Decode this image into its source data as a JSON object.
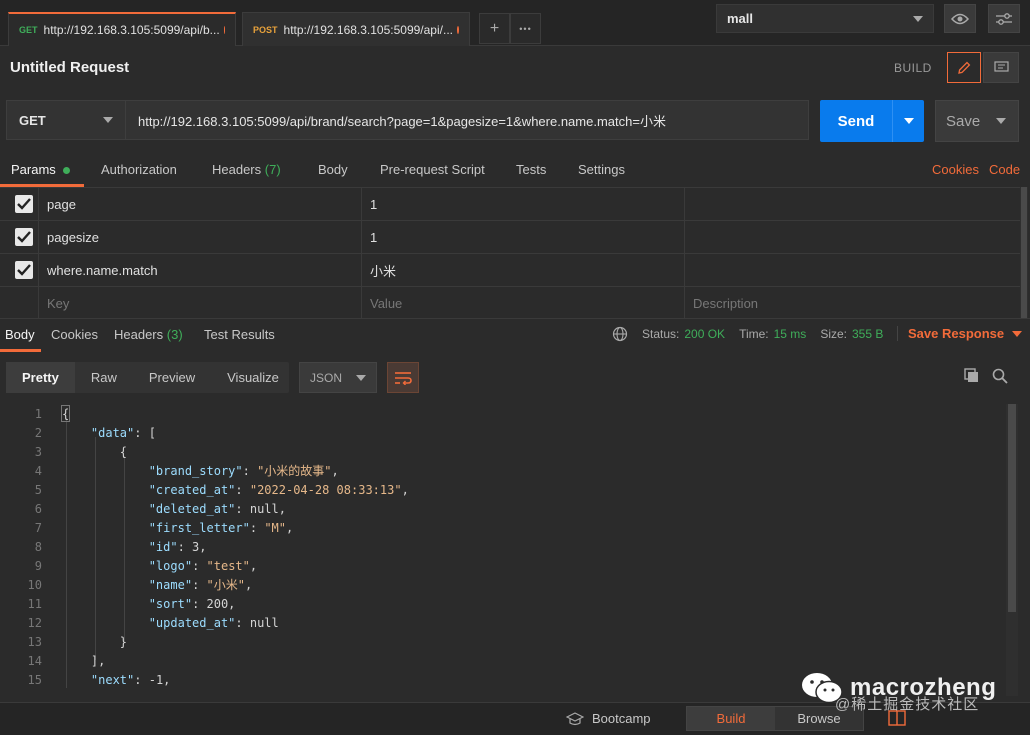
{
  "tabs": [
    {
      "method": "GET",
      "url": "http://192.168.3.105:5099/api/b..."
    },
    {
      "method": "POST",
      "url": "http://192.168.3.105:5099/api/..."
    }
  ],
  "tab_actions": {
    "add": "+",
    "more": "•••"
  },
  "environment": {
    "selected": "mall"
  },
  "request": {
    "title": "Untitled Request",
    "build_label": "BUILD",
    "method": "GET",
    "url": "http://192.168.3.105:5099/api/brand/search?page=1&pagesize=1&where.name.match=小米",
    "send_label": "Send",
    "save_label": "Save"
  },
  "request_tabs": {
    "params": "Params",
    "authorization": "Authorization",
    "headers": "Headers",
    "headers_count": "(7)",
    "body": "Body",
    "prerequest": "Pre-request Script",
    "tests": "Tests",
    "settings": "Settings",
    "cookies": "Cookies",
    "code": "Code"
  },
  "params": [
    {
      "key": "page",
      "value": "1",
      "checked": true
    },
    {
      "key": "pagesize",
      "value": "1",
      "checked": true
    },
    {
      "key": "where.name.match",
      "value": "小米",
      "checked": true
    }
  ],
  "params_placeholder": {
    "key": "Key",
    "value": "Value",
    "description": "Description"
  },
  "response_tabs": {
    "body": "Body",
    "cookies": "Cookies",
    "headers": "Headers",
    "headers_count": "(3)",
    "test_results": "Test Results"
  },
  "response_status": {
    "status_label": "Status:",
    "status_value": "200 OK",
    "time_label": "Time:",
    "time_value": "15 ms",
    "size_label": "Size:",
    "size_value": "355 B",
    "save_response": "Save Response"
  },
  "view_modes": {
    "pretty": "Pretty",
    "raw": "Raw",
    "preview": "Preview",
    "visualize": "Visualize"
  },
  "format": {
    "selected": "JSON"
  },
  "code_lines": [
    "{",
    "    \"data\": [",
    "        {",
    "            \"brand_story\": \"小米的故事\",",
    "            \"created_at\": \"2022-04-28 08:33:13\",",
    "            \"deleted_at\": null,",
    "            \"first_letter\": \"M\",",
    "            \"id\": 3,",
    "            \"logo\": \"test\",",
    "            \"name\": \"小米\",",
    "            \"sort\": 200,",
    "            \"updated_at\": null",
    "        }",
    "    ],",
    "    \"next\": -1,"
  ],
  "footer": {
    "bootcamp": "Bootcamp",
    "build": "Build",
    "browse": "Browse"
  },
  "watermark": {
    "name": "macrozheng",
    "sub": "@稀土掘金技术社区"
  },
  "colors": {
    "accent": "#f26b3a",
    "send_blue": "#097bed",
    "success_green": "#3fae5a"
  }
}
